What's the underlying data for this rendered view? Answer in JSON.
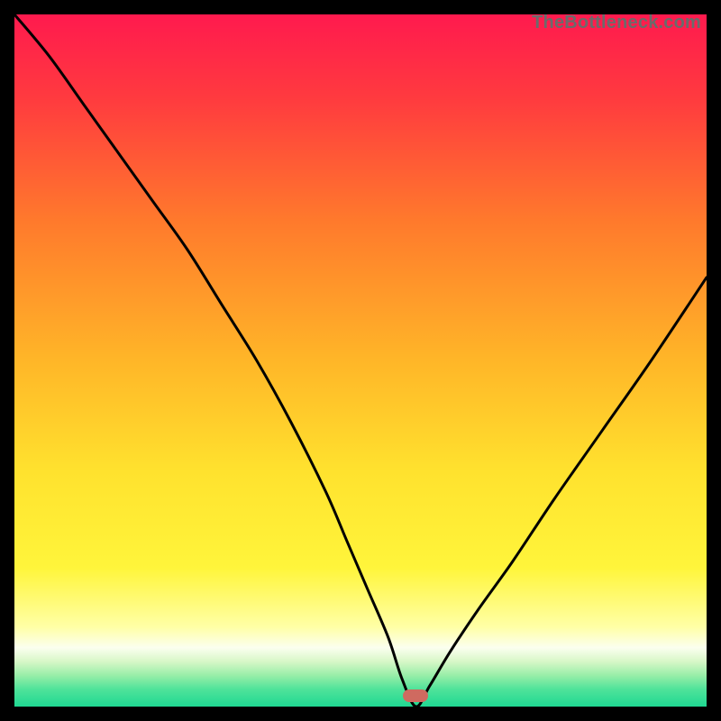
{
  "watermark": {
    "text": "TheBottleneck.com"
  },
  "colors": {
    "frame": "#000000",
    "curve": "#000000",
    "marker": "#cf6a60",
    "gradient_stops": [
      {
        "offset": 0.0,
        "color": "#ff1a4e"
      },
      {
        "offset": 0.12,
        "color": "#ff3a3f"
      },
      {
        "offset": 0.3,
        "color": "#ff7a2c"
      },
      {
        "offset": 0.5,
        "color": "#ffb628"
      },
      {
        "offset": 0.66,
        "color": "#ffe22e"
      },
      {
        "offset": 0.8,
        "color": "#fff53b"
      },
      {
        "offset": 0.885,
        "color": "#ffffa6"
      },
      {
        "offset": 0.915,
        "color": "#fbffef"
      },
      {
        "offset": 0.935,
        "color": "#d7f7c7"
      },
      {
        "offset": 0.955,
        "color": "#98eea8"
      },
      {
        "offset": 0.975,
        "color": "#4fe39a"
      },
      {
        "offset": 1.0,
        "color": "#1fd892"
      }
    ]
  },
  "chart_data": {
    "type": "line",
    "title": "",
    "xlabel": "",
    "ylabel": "",
    "x_range": [
      0,
      100
    ],
    "y_range": [
      0,
      100
    ],
    "note": "Bottleneck-style V curve. X is a normalized component-balance axis (0–100); Y is estimated bottleneck percentage (0–100). Minimum near x≈58 marks the balanced point.",
    "minimum": {
      "x": 58,
      "y": 0
    },
    "series": [
      {
        "name": "bottleneck-curve",
        "x": [
          0,
          5,
          10,
          15,
          20,
          25,
          30,
          35,
          40,
          45,
          48,
          51,
          54,
          56,
          58,
          60,
          63,
          67,
          72,
          78,
          85,
          92,
          100
        ],
        "y": [
          100,
          94,
          87,
          80,
          73,
          66,
          58,
          50,
          41,
          31,
          24,
          17,
          10,
          4,
          0,
          3,
          8,
          14,
          21,
          30,
          40,
          50,
          62
        ]
      }
    ],
    "marker": {
      "x": 58,
      "y": 1.5,
      "shape": "pill",
      "color": "#cf6a60"
    }
  }
}
